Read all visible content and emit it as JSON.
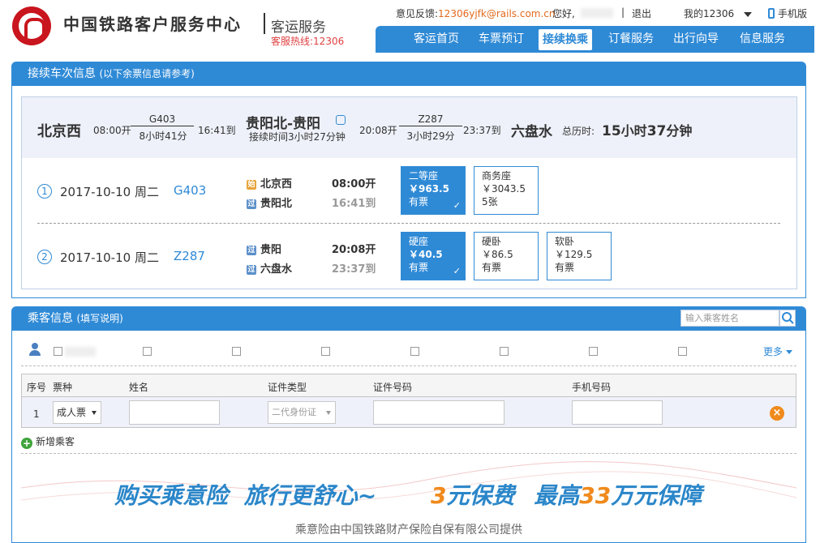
{
  "header": {
    "site_title": "中国铁路客户服务中心",
    "sub_title": "客运服务",
    "hotline": "客服热线:12306",
    "feedback_label": "意见反馈:",
    "feedback_email": "12306yjfk@rails.com.cn",
    "greeting": "您好,",
    "sep": "|",
    "logout": "退出",
    "my12306": "我的12306",
    "mobile": "手机版"
  },
  "nav": {
    "items": [
      "客运首页",
      "车票预订",
      "接续换乘",
      "订餐服务",
      "出行向导",
      "信息服务"
    ],
    "active_index": 2
  },
  "trip_panel": {
    "title": "接续车次信息",
    "note": "(以下余票信息请参考)"
  },
  "summary": {
    "from_station": "北京西",
    "dep1": "08:00开",
    "train1": "G403",
    "dur1": "8小时41分",
    "arr1": "16:41到",
    "transfer": "贵阳北-贵阳",
    "transfer_time": "接续时间3小时27分钟",
    "dep2": "20:08开",
    "train2": "Z287",
    "dur2": "3小时29分",
    "arr2": "23:37到",
    "to_station": "六盘水",
    "total_label": "总历时:",
    "total_h": "15",
    "total_h_unit": "小时",
    "total_m": "37",
    "total_m_unit": "分钟"
  },
  "legs": [
    {
      "num": "1",
      "date": "2017-10-10 周二",
      "train": "G403",
      "from_badge": "始",
      "from": "北京西",
      "to_badge": "过",
      "to": "贵阳北",
      "dep": "08:00开",
      "arr": "16:41到",
      "seats": [
        {
          "type": "二等座",
          "price": "￥963.5",
          "stock": "有票",
          "selected": true
        },
        {
          "type": "商务座",
          "price": "￥3043.5",
          "stock": "5张",
          "selected": false
        }
      ]
    },
    {
      "num": "2",
      "date": "2017-10-10 周二",
      "train": "Z287",
      "from_badge": "过",
      "from": "贵阳",
      "to_badge": "过",
      "to": "六盘水",
      "dep": "20:08开",
      "arr": "23:37到",
      "seats": [
        {
          "type": "硬座",
          "price": "￥40.5",
          "stock": "有票",
          "selected": true
        },
        {
          "type": "硬卧",
          "price": "￥86.5",
          "stock": "有票",
          "selected": false
        },
        {
          "type": "软卧",
          "price": "￥129.5",
          "stock": "有票",
          "selected": false
        }
      ]
    }
  ],
  "passenger_panel": {
    "title": "乘客信息",
    "note": "(填写说明)",
    "search_placeholder": "输入乘客姓名",
    "more": "更多",
    "add_passenger": "新增乘客"
  },
  "table": {
    "headers": [
      "序号",
      "票种",
      "姓名",
      "证件类型",
      "证件号码",
      "手机号码"
    ],
    "row": {
      "index": "1",
      "ticket_type": "成人票",
      "id_type": "二代身份证"
    }
  },
  "banner": {
    "slogan_a": "购买乘意险",
    "slogan_b": "旅行更舒心~",
    "price_num": "3",
    "price_text": "元保费",
    "max_text": "最高",
    "max_num": "33",
    "max_tail": "万元保障",
    "provider": "乘意险由中国铁路财产保险自保有限公司提供"
  },
  "colors": {
    "primary": "#2f8ad6",
    "brand_red": "#c9151e",
    "accent_orange": "#f08a1c"
  }
}
